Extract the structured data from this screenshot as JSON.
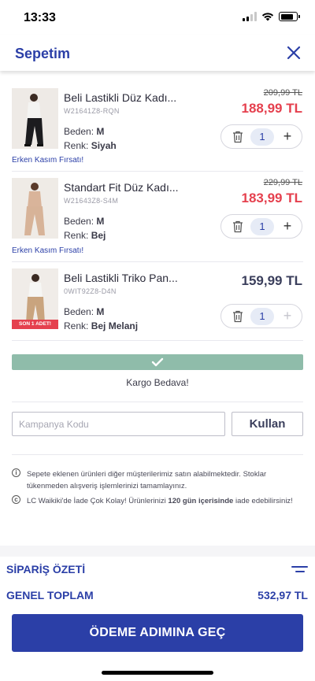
{
  "status_bar": {
    "time": "13:33"
  },
  "header": {
    "title": "Sepetim"
  },
  "items": [
    {
      "name": "Beli Lastikli Düz Kadı...",
      "code": "W21641Z8-RQN",
      "size_label": "Beden:",
      "size": "M",
      "color_label": "Renk:",
      "color": "Siyah",
      "old_price": "209,99 TL",
      "price": "188,99 TL",
      "quantity": "1",
      "promo": "Erken Kasım Fırsatı!"
    },
    {
      "name": "Standart Fit Düz Kadı...",
      "code": "W21643Z8-S4M",
      "size_label": "Beden:",
      "size": "M",
      "color_label": "Renk:",
      "color": "Bej",
      "old_price": "229,99 TL",
      "price": "183,99 TL",
      "quantity": "1",
      "promo": "Erken Kasım Fırsatı!"
    },
    {
      "name": "Beli Lastikli Triko Pan...",
      "code": "0WIT92Z8-D4N",
      "size_label": "Beden:",
      "size": "M",
      "color_label": "Renk:",
      "color": "Bej Melanj",
      "price": "159,99 TL",
      "quantity": "1",
      "badge": "SON 1 ADET!"
    }
  ],
  "shipping": {
    "text": "Kargo Bedava!"
  },
  "coupon": {
    "placeholder": "Kampanya Kodu",
    "button": "Kullan"
  },
  "info": [
    {
      "icon": "ⓘ",
      "text": "Sepete eklenen ürünleri diğer müşterilerimiz satın alabilmektedir. Stoklar tükenmeden alışveriş işlemlerinizi tamamlayınız."
    },
    {
      "icon": "©",
      "text_prefix": "LC Waikiki'de İade Çok Kolay! Ürünlerinizi ",
      "text_bold": "120 gün içerisinde",
      "text_suffix": " iade edebilirsiniz!"
    }
  ],
  "summary": {
    "title": "SİPARİŞ ÖZETİ",
    "total_label": "GENEL TOPLAM",
    "total_value": "532,97 TL",
    "checkout": "ÖDEME ADIMINA GEÇ"
  },
  "colors": {
    "brand_blue": "#2b3fa7",
    "price_red": "#e5404e",
    "shipping_green": "#8fbcaa"
  }
}
